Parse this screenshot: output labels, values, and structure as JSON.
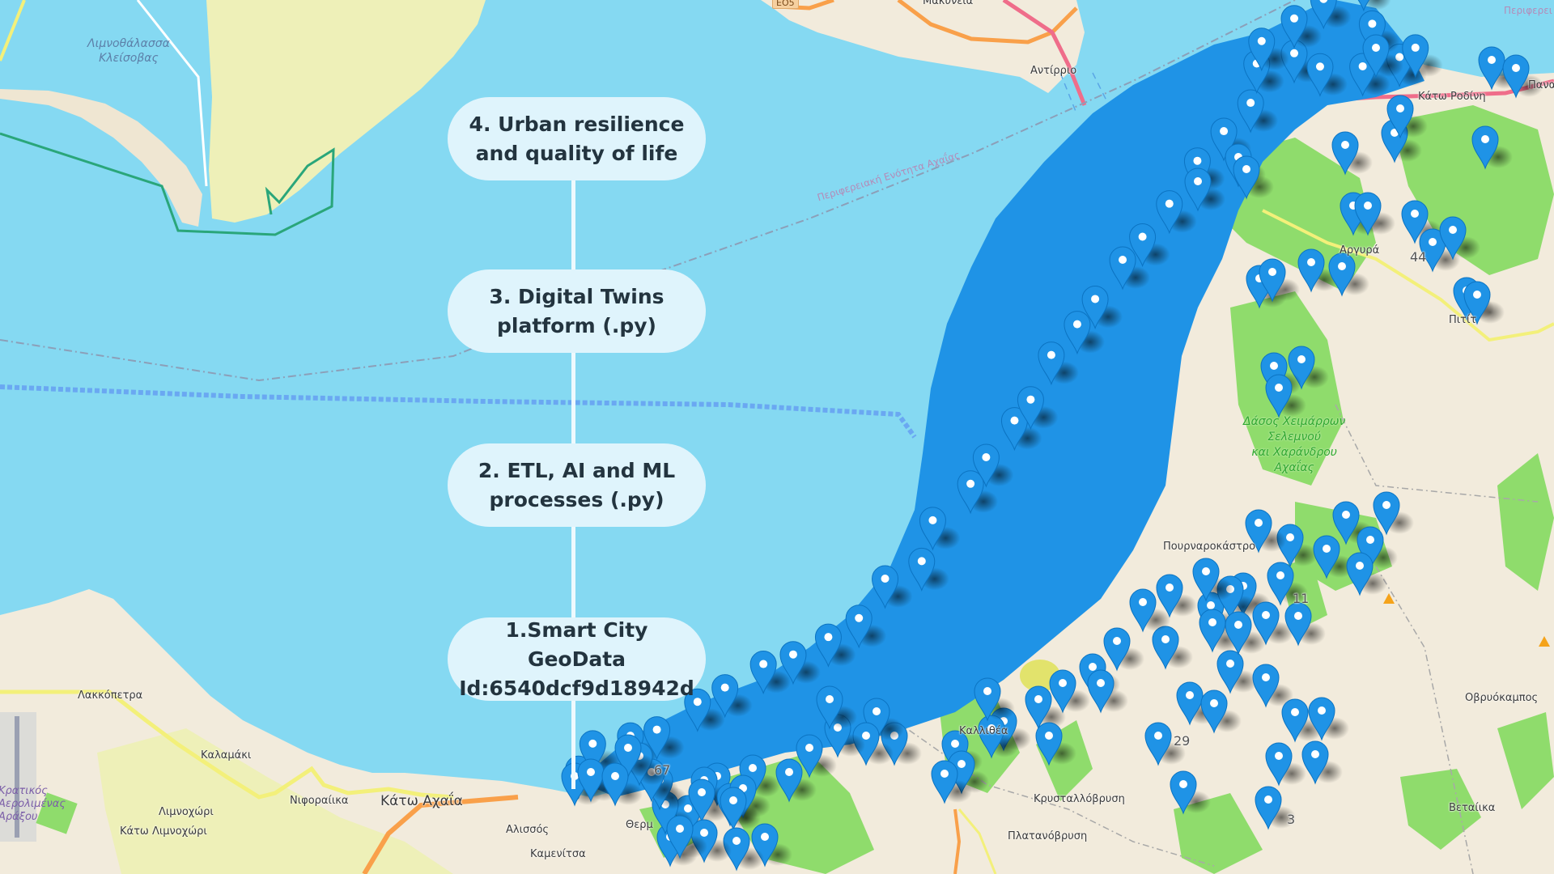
{
  "steps": [
    {
      "label": "4. Urban resilience\nand quality of life"
    },
    {
      "label": "3. Digital Twins\nplatform (.py)"
    },
    {
      "label": "2. ETL, AI and ML\nprocesses (.py)"
    },
    {
      "label": "1.Smart City GeoData\nId:6540dcf9d18942d"
    }
  ],
  "map": {
    "colors": {
      "water": "#85d9f2",
      "land": "#f2ebdc",
      "farmland": "#eef0b8",
      "forest": "#8fdc6c",
      "marker": "#1f93e6",
      "primary_road": "#f9a04a",
      "motorway": "#ef6d8a",
      "secondary_road": "#f3f07a",
      "boundary": "#2aa67a"
    },
    "road_shield": "EO5",
    "place_labels": {
      "lagoon": "Λιμνοθάλασσα\nΚλείσοβας",
      "makyneia": "Μακύνεια",
      "antirrio": "Αντίρριο",
      "admin_region": "Περιφερειακή Ενότητα Αχαΐας",
      "admin_region_partial": "Περιφερει",
      "kato_rodini": "Κάτω Ροδίνη",
      "panag": "Πανα",
      "argyra": "Αργυρά",
      "pitit": "Πιτίτ",
      "forest_area": "Δάσος Χειμάρρων\nΣελεμνού\nκαι Χαράνδρου\nΑχαΐας",
      "pourna": "Πουρναροκάστρο",
      "ovryokampos": "Οβρυόκαμπος",
      "kallithea": "Καλλιθέα",
      "krystallovrysi": "Κρυσταλλόβρυση",
      "vetaika": "Βεταίικα",
      "platanovrysi": "Πλατανόβρυση",
      "lakkopetra": "Λακκόπετρα",
      "kalamaki": "Καλαμάκι",
      "niforaiika": "Νιφοραίικα",
      "kato_achaia": "Κάτω Αχαΐα",
      "limnochori": "Λιμνοχώρι",
      "kato_limnochori": "Κάτω Λιμνοχώρι",
      "alissos": "Αλισσός",
      "kamenitsa": "Καμενίτσα",
      "therm": "Θερμ",
      "airport": "Κρατικός\nΑερολιμένας\nΑράξου",
      "num_29": "29",
      "num_11": "11",
      "num_67": "67",
      "num_44": "44",
      "num_3": "3"
    }
  }
}
